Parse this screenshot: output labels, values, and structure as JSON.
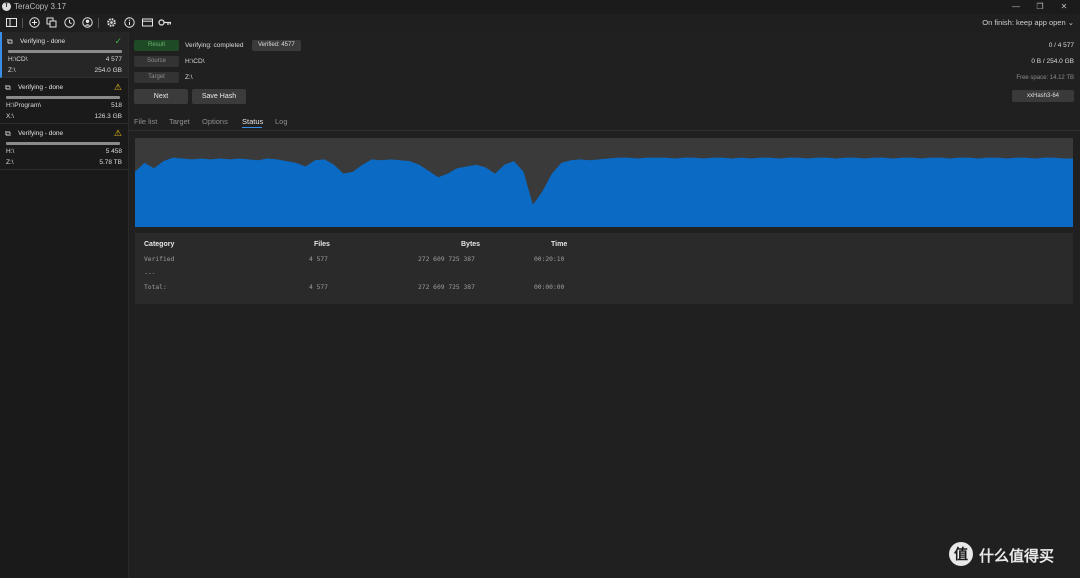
{
  "app": {
    "title": "TeraCopy 3.17",
    "logo_glyph": "T"
  },
  "window": {
    "minimize": "—",
    "restore": "❐",
    "close": "✕"
  },
  "toolbar": {
    "icons": [
      "sidebar-toggle-icon",
      "add-icon",
      "copy-icon",
      "history-icon",
      "user-icon",
      "gear-icon",
      "info-icon",
      "card-icon",
      "key-icon"
    ],
    "on_finish": "On finish: keep app open ⌄"
  },
  "jobs": [
    {
      "status": "Verifying - done",
      "mark": "✓",
      "mark_type": "ok",
      "source": "H:\\CD\\",
      "count": "4 577",
      "target": "Z:\\",
      "size": "254.0 GB"
    },
    {
      "status": "Verifying - done",
      "mark": "⚠",
      "mark_type": "warn",
      "source": "H:\\Program\\",
      "count": "518",
      "target": "X:\\",
      "size": "126.3 GB"
    },
    {
      "status": "Verifying - done",
      "mark": "⚠",
      "mark_type": "warn",
      "source": "H:\\",
      "count": "5 458",
      "target": "Z:\\",
      "size": "5.78 TB"
    }
  ],
  "details": {
    "result_label": "Result",
    "result_text": "Verifying: completed",
    "verified_chip": "Verified: 4577",
    "source_label": "Source",
    "source_text": "H:\\CD\\",
    "target_label": "Target",
    "target_text": "Z:\\",
    "files_progress": "0 / 4 577",
    "bytes_progress": "0 B / 254.0 GB",
    "free_space": "Free space: 14.12 TB",
    "next_button": "Next",
    "save_hash_button": "Save Hash",
    "hash_algo": "xxHash3-64"
  },
  "tabs": [
    {
      "label": "File list"
    },
    {
      "label": "Target"
    },
    {
      "label": "Options"
    },
    {
      "label": "Status"
    },
    {
      "label": "Log"
    }
  ],
  "active_tab": "Status",
  "graph": {
    "colors": {
      "fill": "#0a6ac4",
      "background": "#3a3a3a"
    },
    "levels": [
      0.62,
      0.72,
      0.66,
      0.74,
      0.78,
      0.77,
      0.76,
      0.77,
      0.76,
      0.77,
      0.76,
      0.77,
      0.76,
      0.75,
      0.77,
      0.76,
      0.74,
      0.72,
      0.68,
      0.75,
      0.76,
      0.7,
      0.6,
      0.62,
      0.7,
      0.76,
      0.75,
      0.76,
      0.75,
      0.74,
      0.7,
      0.63,
      0.56,
      0.6,
      0.66,
      0.68,
      0.7,
      0.67,
      0.6,
      0.7,
      0.74,
      0.62,
      0.25,
      0.4,
      0.6,
      0.72,
      0.75,
      0.76,
      0.75,
      0.76,
      0.77,
      0.78,
      0.78,
      0.77,
      0.78,
      0.78,
      0.78,
      0.77,
      0.78,
      0.78,
      0.77,
      0.78,
      0.78,
      0.77,
      0.78,
      0.77,
      0.78,
      0.78,
      0.77,
      0.78,
      0.78,
      0.77,
      0.78,
      0.78,
      0.77,
      0.78,
      0.78,
      0.77,
      0.78,
      0.78,
      0.77,
      0.78,
      0.78,
      0.77,
      0.78,
      0.78,
      0.77,
      0.78,
      0.78,
      0.77,
      0.78,
      0.78,
      0.77,
      0.78,
      0.78,
      0.77,
      0.78,
      0.78,
      0.77,
      0.77
    ]
  },
  "stats": {
    "headers": {
      "category": "Category",
      "files": "Files",
      "bytes": "Bytes",
      "time": "Time"
    },
    "rows": [
      {
        "category": "Verified",
        "files": "4 577",
        "bytes": "272 609 725 387",
        "time": "00:20:10"
      },
      {
        "category": "---",
        "files": "",
        "bytes": "",
        "time": ""
      },
      {
        "category": "Total:",
        "files": "4 577",
        "bytes": "272 609 725 387",
        "time": "00:00:00"
      }
    ]
  },
  "watermark": {
    "glyph": "值",
    "text": "什么值得买"
  }
}
